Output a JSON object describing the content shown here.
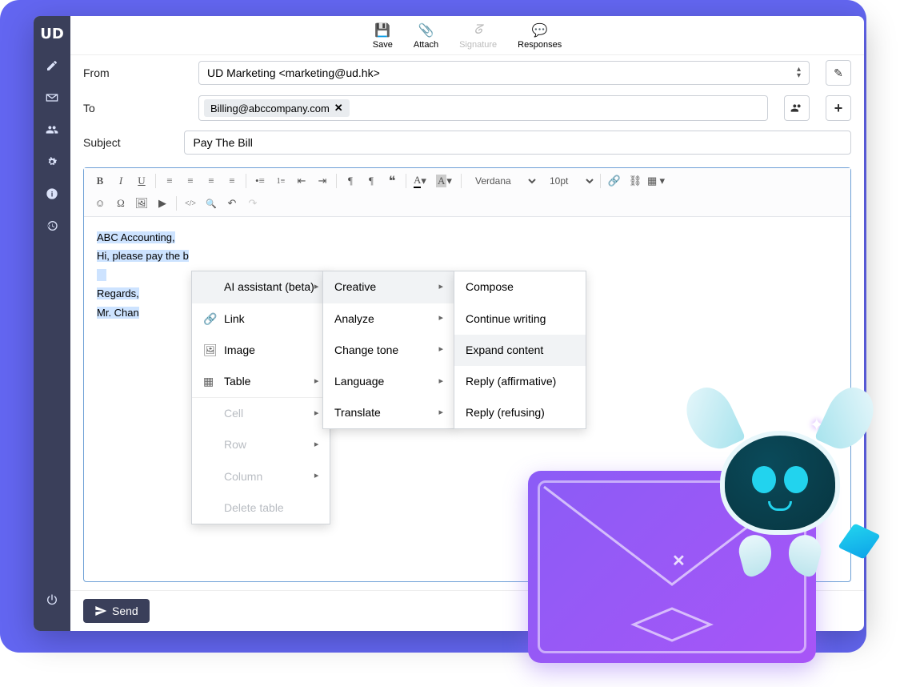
{
  "sidebar": {
    "logo": "UD"
  },
  "toolbar": {
    "save": "Save",
    "attach": "Attach",
    "signature": "Signature",
    "responses": "Responses"
  },
  "fields": {
    "from_label": "From",
    "from_value": "UD Marketing <marketing@ud.hk>",
    "to_label": "To",
    "to_chips": [
      "Billing@abccompany.com"
    ],
    "subject_label": "Subject",
    "subject_value": "Pay The Bill"
  },
  "editor": {
    "font_family": "Verdana",
    "font_size": "10pt",
    "body_lines": [
      "ABC Accounting,",
      "Hi, please pay the b",
      "",
      "Regards,",
      "Mr. Chan"
    ]
  },
  "context_menu": {
    "level1": [
      {
        "label": "AI assistant (beta)",
        "icon": "",
        "arrow": true,
        "hover": true
      },
      {
        "label": "Link",
        "icon": "link"
      },
      {
        "label": "Image",
        "icon": "image"
      },
      {
        "label": "Table",
        "icon": "table",
        "arrow": true
      },
      {
        "label": "Cell",
        "arrow": true,
        "disabled": true
      },
      {
        "label": "Row",
        "arrow": true,
        "disabled": true
      },
      {
        "label": "Column",
        "arrow": true,
        "disabled": true
      },
      {
        "label": "Delete table",
        "disabled": true
      }
    ],
    "level2": [
      {
        "label": "Creative",
        "arrow": true,
        "hover": true
      },
      {
        "label": "Analyze",
        "arrow": true
      },
      {
        "label": "Change tone",
        "arrow": true
      },
      {
        "label": "Language",
        "arrow": true
      },
      {
        "label": "Translate",
        "arrow": true
      }
    ],
    "level3": [
      {
        "label": "Compose"
      },
      {
        "label": "Continue writing"
      },
      {
        "label": "Expand content",
        "hover": true
      },
      {
        "label": "Reply (affirmative)"
      },
      {
        "label": "Reply (refusing)"
      }
    ]
  },
  "footer": {
    "send": "Send"
  }
}
